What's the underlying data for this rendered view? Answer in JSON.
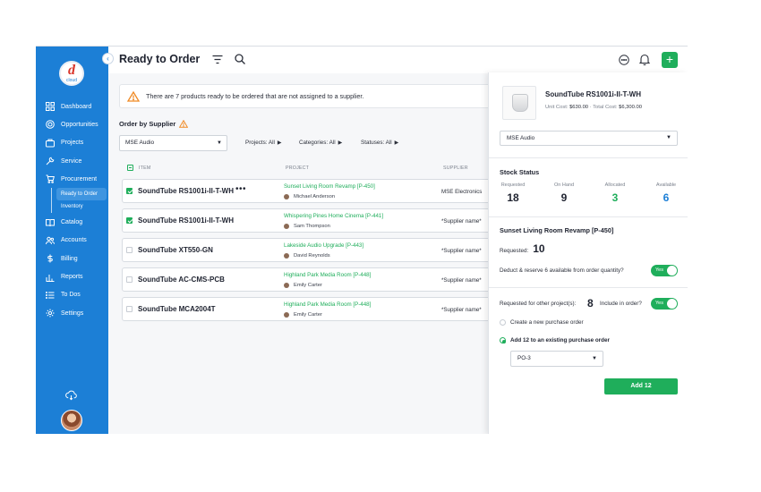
{
  "sidebar": {
    "logo_letter": "d",
    "logo_text": "cloud",
    "items": [
      {
        "label": "Dashboard",
        "icon": "grid-icon"
      },
      {
        "label": "Opportunities",
        "icon": "target-icon"
      },
      {
        "label": "Projects",
        "icon": "folder-icon"
      },
      {
        "label": "Service",
        "icon": "wrench-icon"
      },
      {
        "label": "Procurement",
        "icon": "cart-icon"
      },
      {
        "label": "Catalog",
        "icon": "book-icon"
      },
      {
        "label": "Accounts",
        "icon": "users-icon"
      },
      {
        "label": "Billing",
        "icon": "dollar-icon"
      },
      {
        "label": "Reports",
        "icon": "chart-icon"
      },
      {
        "label": "To Dos",
        "icon": "list-icon"
      },
      {
        "label": "Settings",
        "icon": "gear-icon"
      }
    ],
    "procurement_sub": [
      {
        "label": "Ready to Order",
        "active": true
      },
      {
        "label": "Inventory",
        "active": false
      }
    ]
  },
  "header": {
    "title": "Ready to Order"
  },
  "alert": {
    "text": "There are 7 products ready to be ordered that are not assigned to a supplier."
  },
  "order_by": {
    "label": "Order by Supplier",
    "supplier": "MSE Audio"
  },
  "filters": {
    "projects": "Projects: All",
    "categories": "Categories: All",
    "statuses": "Statuses: All"
  },
  "table": {
    "headers": {
      "item": "ITEM",
      "project": "PROJECT",
      "supplier": "SUPPLIER"
    },
    "rows": [
      {
        "item": "SoundTube RS1001i-II-T-WH",
        "more": "•••",
        "project": "Sunset Living Room Revamp [P-450]",
        "person": "Michael Anderson",
        "supplier": "MSE Electronics",
        "checked": true
      },
      {
        "item": "SoundTube RS1001i-II-T-WH",
        "more": "",
        "project": "Whispering Pines Home Cinema [P-441]",
        "person": "Sam Thompson",
        "supplier": "*Supplier name*",
        "checked": true
      },
      {
        "item": "SoundTube XT550-GN",
        "more": "",
        "project": "Lakeside Audio Upgrade [P-443]",
        "person": "David Reynolds",
        "supplier": "*Supplier name*",
        "checked": false
      },
      {
        "item": "SoundTube AC-CMS-PCB",
        "more": "",
        "project": "Highland Park Media Room [P-448]",
        "person": "Emily Carter",
        "supplier": "*Supplier name*",
        "checked": false
      },
      {
        "item": "SoundTube MCA2004T",
        "more": "",
        "project": "Highland Park Media Room [P-448]",
        "person": "Emily Carter",
        "supplier": "*Supplier name*",
        "checked": false
      }
    ]
  },
  "panel": {
    "product_name": "SoundTube RS1001i-II-T-WH",
    "unit_cost_label": "Unit Cost:",
    "unit_cost": "$630.00",
    "total_cost_label": "Total Cost:",
    "total_cost": "$6,300.00",
    "supplier": "MSE Audio",
    "stock_title": "Stock Status",
    "stock": [
      {
        "label": "Requested",
        "value": "18"
      },
      {
        "label": "On Hand",
        "value": "9"
      },
      {
        "label": "Allocated",
        "value": "3"
      },
      {
        "label": "Available",
        "value": "6"
      }
    ],
    "project_title": "Sunset Living Room Revamp [P-450]",
    "requested_label": "Requested:",
    "requested_value": "10",
    "deduct_label": "Deduct & reserve 6 available from order quantity?",
    "deduct_toggle": "Yes",
    "other_label": "Requested for other project(s):",
    "other_value": "8",
    "include_label": "Include in order?",
    "include_toggle": "Yes",
    "radio_new": "Create a new purchase order",
    "radio_existing": "Add 12 to an existing purchase order",
    "po_value": "PO-3",
    "add_button": "Add 12"
  },
  "colors": {
    "sidebar": "#1c7fd6",
    "accent_green": "#1fae5b",
    "warning": "#f08a24"
  }
}
